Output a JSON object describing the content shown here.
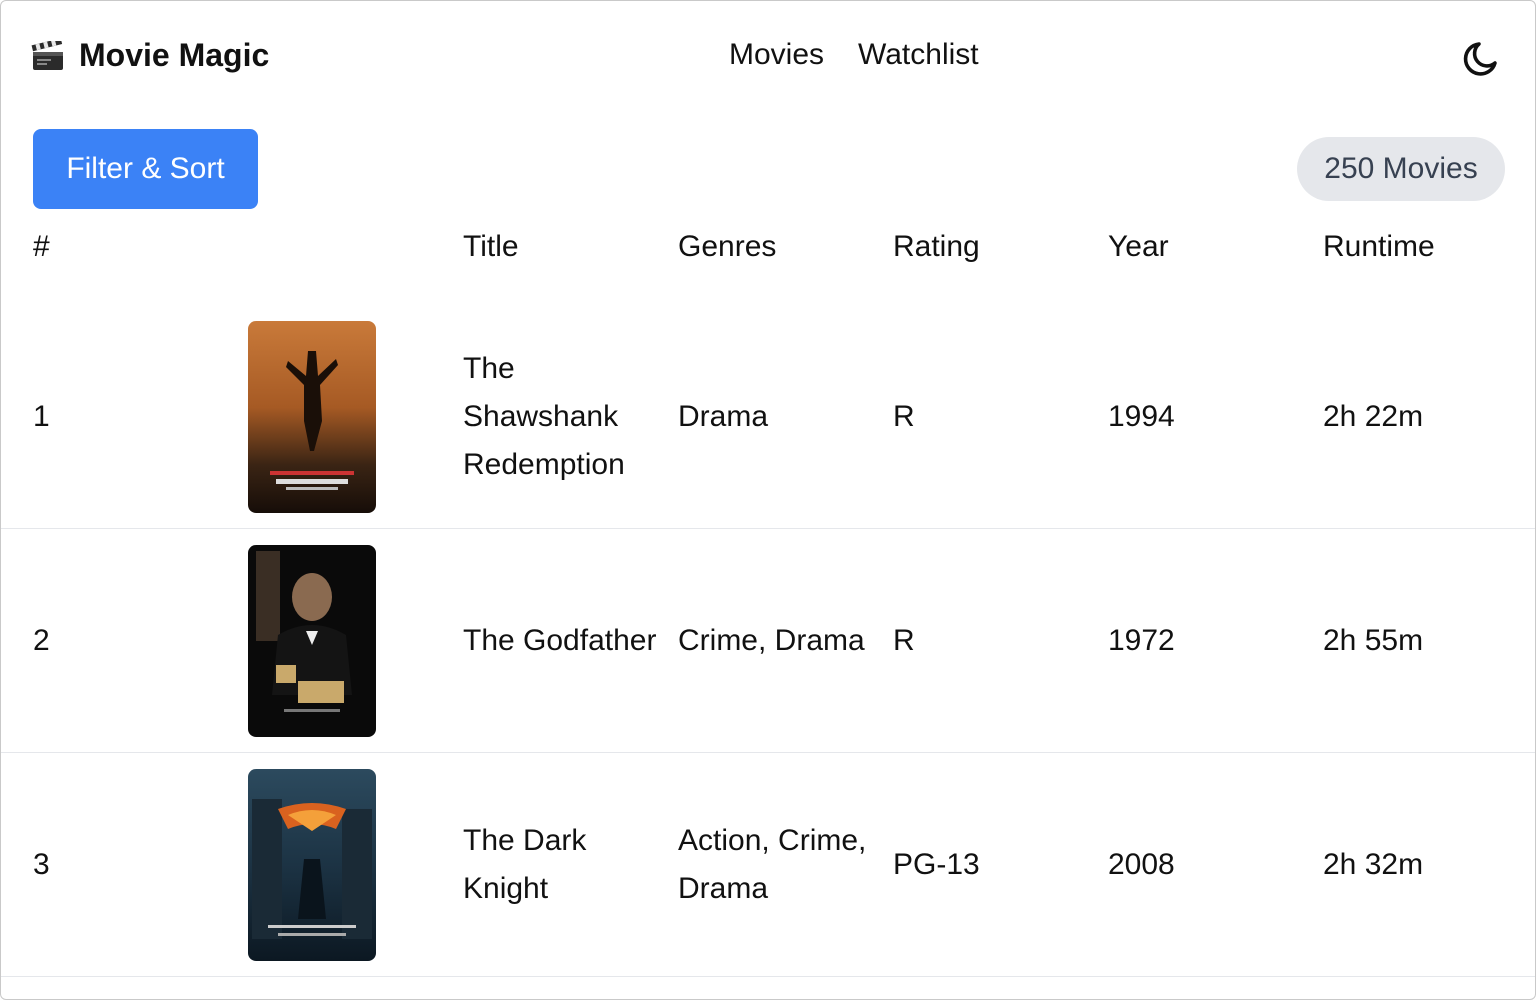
{
  "app": {
    "name": "Movie Magic",
    "logo_icon": "clapperboard-icon"
  },
  "nav": {
    "items": [
      "Movies",
      "Watchlist"
    ]
  },
  "theme_toggle": {
    "icon": "moon-icon"
  },
  "toolbar": {
    "filter_label": "Filter & Sort",
    "count_label": "250 Movies"
  },
  "colors": {
    "accent": "#3b82f6",
    "badge_bg": "#e5e7eb",
    "divider": "#e5e7eb"
  },
  "table": {
    "headers": [
      "#",
      "",
      "Title",
      "Genres",
      "Rating",
      "Year",
      "Runtime"
    ],
    "rows": [
      {
        "rank": "1",
        "poster": "shawshank-poster",
        "title": "The Shawshank Redemption",
        "genres": "Drama",
        "rating": "R",
        "year": "1994",
        "runtime": "2h 22m"
      },
      {
        "rank": "2",
        "poster": "godfather-poster",
        "title": "The Godfather",
        "genres": "Crime, Drama",
        "rating": "R",
        "year": "1972",
        "runtime": "2h 55m"
      },
      {
        "rank": "3",
        "poster": "dark-knight-poster",
        "title": "The Dark Knight",
        "genres": "Action, Crime, Drama",
        "rating": "PG-13",
        "year": "2008",
        "runtime": "2h 32m"
      }
    ]
  }
}
